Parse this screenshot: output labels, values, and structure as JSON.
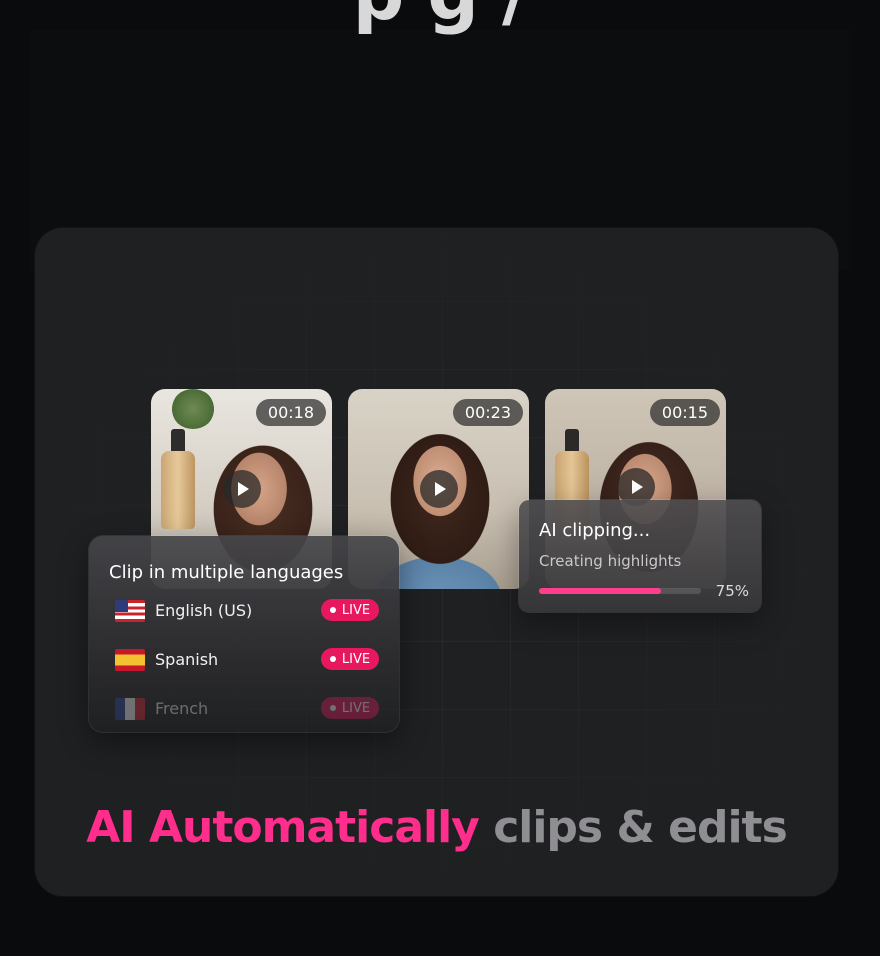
{
  "top_heading_fragment": "p  g  /",
  "clips": [
    {
      "duration": "00:18"
    },
    {
      "duration": "00:23"
    },
    {
      "duration": "00:15"
    }
  ],
  "languages_panel": {
    "title": "Clip in multiple languages",
    "items": [
      {
        "name": "English (US)",
        "flag": "us-flag-icon",
        "badge": "LIVE"
      },
      {
        "name": "Spanish",
        "flag": "spain-flag-icon",
        "badge": "LIVE"
      },
      {
        "name": "French",
        "flag": "france-flag-icon",
        "badge": "LIVE"
      }
    ]
  },
  "ai_panel": {
    "title": "AI clipping...",
    "subtitle": "Creating highlights",
    "progress": 0.75,
    "progress_label": "75%"
  },
  "headline": {
    "accent": "AI Automatically",
    "rest": "clips & edits"
  },
  "colors": {
    "accent": "#ff2d8c",
    "live_badge": "#e8185f",
    "progress": "#ff3f8e",
    "background": "#0a0b0c",
    "card": "#1f2022"
  }
}
